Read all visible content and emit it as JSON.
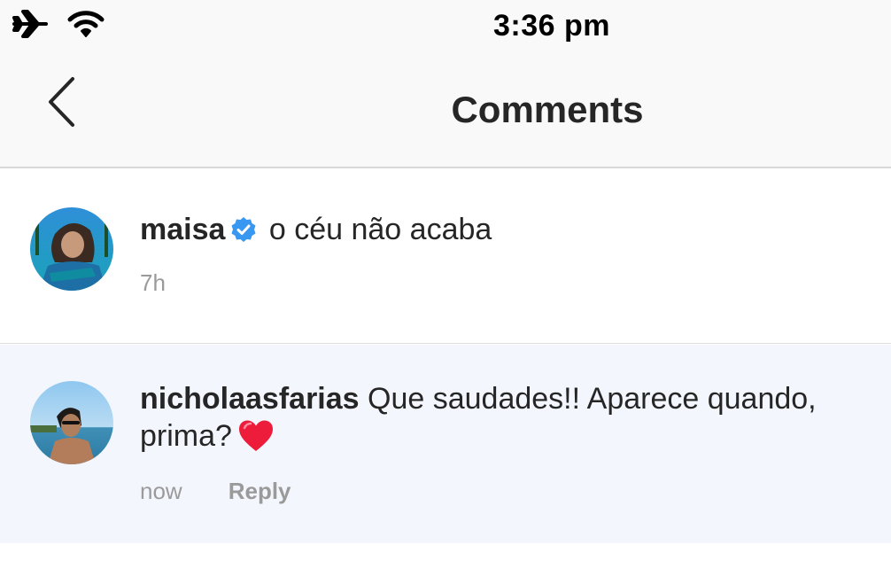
{
  "status_bar": {
    "time": "3:36 pm",
    "icons": [
      "airplane-icon",
      "wifi-icon"
    ]
  },
  "nav": {
    "title": "Comments",
    "back_icon": "chevron-left-icon"
  },
  "comments": [
    {
      "username": "maisa",
      "verified": true,
      "text": "o céu não acaba",
      "time": "7h",
      "avatar": "avatar-photo"
    },
    {
      "username": "nicholaasfarias",
      "verified": false,
      "text": "Que saudades!! Aparece quando, prima?",
      "emoji": "❤️",
      "time": "now",
      "reply_label": "Reply",
      "avatar": "avatar-photo"
    }
  ],
  "colors": {
    "header_bg": "#f9f9f9",
    "highlight_bg": "#f3f7fd",
    "verified_blue": "#3897f0",
    "heart_red": "#ed1c3a",
    "meta_gray": "#9a9a9a"
  }
}
